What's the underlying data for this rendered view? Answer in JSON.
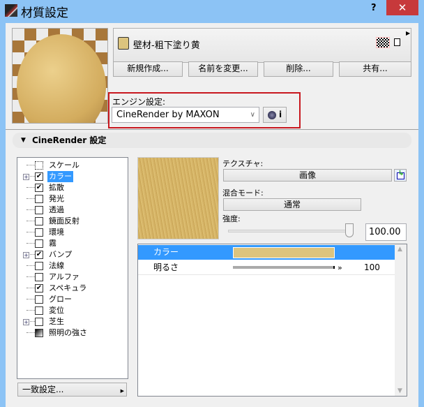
{
  "window": {
    "title": "材質設定",
    "help": "?",
    "close": "✕"
  },
  "material": {
    "name": "壁材-粗下塗り黄",
    "swatch_color": "#dcc47e",
    "icons": [
      "hatch-pattern-icon",
      "document-icon"
    ]
  },
  "buttons": {
    "new": "新規作成...",
    "rename": "名前を変更...",
    "delete": "削除...",
    "share": "共有..."
  },
  "engine": {
    "label": "エンジン設定:",
    "selected": "CineRender by MAXON",
    "info": "i"
  },
  "section": {
    "title": "CineRender 設定"
  },
  "tree": [
    {
      "label": "スケール",
      "checked": null,
      "expand": false
    },
    {
      "label": "カラー",
      "checked": true,
      "expand": true,
      "selected": true
    },
    {
      "label": "拡散",
      "checked": true,
      "expand": false
    },
    {
      "label": "発光",
      "checked": false,
      "expand": false
    },
    {
      "label": "透過",
      "checked": false,
      "expand": false
    },
    {
      "label": "鏡面反射",
      "checked": false,
      "expand": false
    },
    {
      "label": "環境",
      "checked": false,
      "expand": false
    },
    {
      "label": "霧",
      "checked": false,
      "expand": false
    },
    {
      "label": "バンプ",
      "checked": true,
      "expand": true
    },
    {
      "label": "法線",
      "checked": false,
      "expand": false
    },
    {
      "label": "アルファ",
      "checked": false,
      "expand": false
    },
    {
      "label": "スペキュラ",
      "checked": true,
      "expand": false
    },
    {
      "label": "グロー",
      "checked": false,
      "expand": false
    },
    {
      "label": "変位",
      "checked": false,
      "expand": false
    },
    {
      "label": "芝生",
      "checked": false,
      "expand": true
    },
    {
      "label": "照明の強さ",
      "checked": null,
      "expand": false
    }
  ],
  "match_button": "一致設定...",
  "texture": {
    "label": "テクスチャ:",
    "button": "画像"
  },
  "blend": {
    "label": "混合モード:",
    "button": "通常"
  },
  "strength": {
    "label": "強度:",
    "value": "100.00",
    "slider_percent": 100
  },
  "properties": [
    {
      "name": "カラー",
      "color": "#dcc47e"
    },
    {
      "name": "明るさ",
      "value": "100",
      "slider_percent": 100
    }
  ]
}
